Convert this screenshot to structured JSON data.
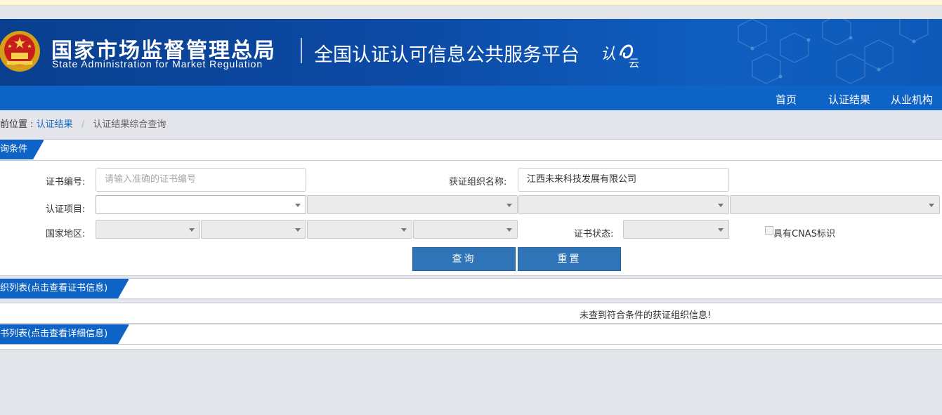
{
  "header": {
    "agency_cn": "国家市场监督管理总局",
    "agency_en": "State Administration  for  Market Regulation",
    "platform": "全国认证认可信息公共服务平台",
    "mini_logo_a": "认",
    "mini_logo_b": "云"
  },
  "nav": {
    "items": [
      {
        "label": "首页"
      },
      {
        "label": "认证结果"
      },
      {
        "label": "从业机构"
      }
    ]
  },
  "breadcrumb": {
    "prefix": "前位置 :",
    "link": "认证结果",
    "separator": "/",
    "current": "认证结果综合查询"
  },
  "query": {
    "section_title": "询条件",
    "cert_no_label": "证书编号:",
    "cert_no_placeholder": "请输入准确的证书编号",
    "org_name_label": "获证组织名称:",
    "org_name_value": "江西未来科技发展有限公司",
    "project_label": "认证项目:",
    "region_label": "国家地区:",
    "status_label": "证书状态:",
    "cnas_label": "具有CNAS标识",
    "search_button": "查询",
    "reset_button": "重置"
  },
  "results": {
    "org_list_title": "织列表(点击查看证书信息)",
    "empty_message": "未查到符合条件的获证组织信息!",
    "cert_list_title": "书列表(点击查看详细信息)"
  },
  "colors": {
    "banner_dark": "#0a3f8f",
    "nav_blue": "#0e63c6",
    "button_blue": "#2f74b7",
    "link_blue": "#1a6bc8"
  }
}
